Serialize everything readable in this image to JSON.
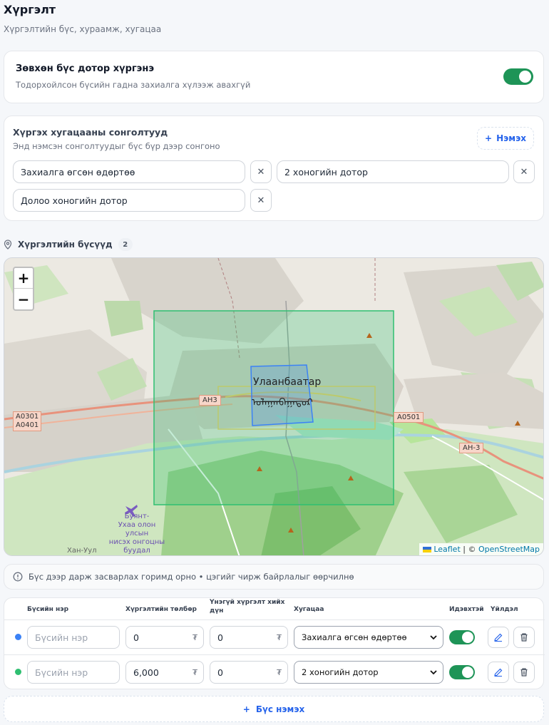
{
  "header": {
    "title": "Хүргэлт",
    "subtitle": "Хүргэлтийн бүс, хураамж, хугацаа"
  },
  "zone_only": {
    "title": "Зөвхөн бүс дотор хүргэнэ",
    "description": "Тодорхойлсон бүсийн гадна захиалга хүлээж авахгүй",
    "enabled": true
  },
  "time_options": {
    "title": "Хүргэх хугацааны сонголтууд",
    "description": "Энд нэмсэн сонголтуудыг бүс бүр дээр сонгоно",
    "add_label": "Нэмэх",
    "items": [
      {
        "label": "Захиалга өгсөн өдөртөө"
      },
      {
        "label": "2 хоногийн дотор"
      },
      {
        "label": "Долоо хоногийн дотор"
      }
    ]
  },
  "zones": {
    "title": "Хүргэлтийн бүсүүд",
    "count": "2"
  },
  "map": {
    "zoom_in": "+",
    "zoom_out": "−",
    "city_label": "Улаанбаатар",
    "city_label_mongolian_script": "ᠤᠯᠠᠭᠠᠨᠪᠠᠭᠠᠲᠤᠷ",
    "road_labels": [
      "A0301",
      "A0401",
      "АН3",
      "A0501",
      "АН-3"
    ],
    "airport_label": [
      "Буянт-",
      "Ухаа олон",
      "улсын",
      "нисэх онгоцны",
      "буудал"
    ],
    "district_label": "Хан-Уул",
    "attribution_leaflet": "Leaflet",
    "attribution_sep": " | © ",
    "attribution_osm": "OpenStreetMap",
    "colors": {
      "zone_green": "#2fbf71",
      "zone_blue": "#3b82f6"
    }
  },
  "hint": "Бүс дээр дарж засварлах горимд орно • цэгийг чирж байрлалыг өөрчилнө",
  "table": {
    "headers": {
      "name": "Бүсийн нэр",
      "fee": "Хүргэлтийн төлбөр",
      "free_min_line1": "Үнэгүй хүргэлт хийх",
      "free_min_line2": "дүн",
      "time": "Хугацаа",
      "active": "Идэвхтэй",
      "actions": "Үйлдэл"
    },
    "currency": "₮",
    "name_placeholder": "Бүсийн нэр",
    "rows": [
      {
        "color": "#3b82f6",
        "name": "",
        "fee": "0",
        "free_min": "0",
        "time": "Захиалга өгсөн өдөртөө",
        "active": true
      },
      {
        "color": "#2fbf71",
        "name": "",
        "fee": "6,000",
        "free_min": "0",
        "time": "2 хоногийн дотор",
        "active": true
      }
    ]
  },
  "add_zone_label": "Бүс нэмэх"
}
